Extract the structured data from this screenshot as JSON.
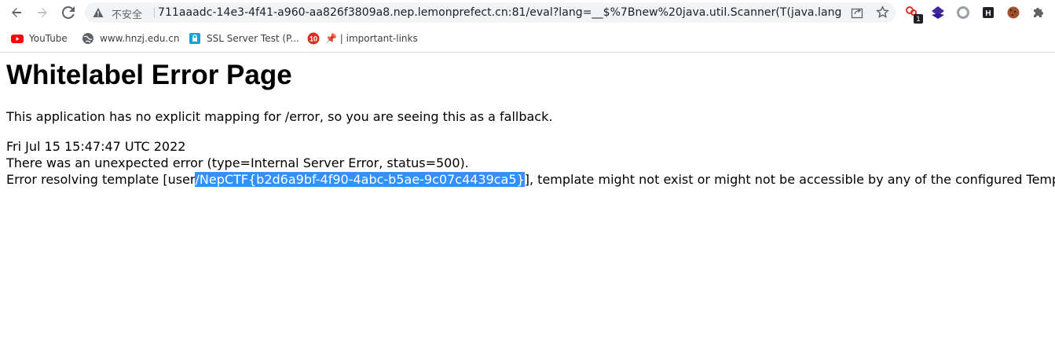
{
  "browser": {
    "security_label": "不安全",
    "url": "711aaadc-14e3-4f41-a960-aa826f3809a8.nep.lemonprefect.cn:81/eval?lang=__$%7Bnew%20java.util.Scanner(T(java.lang.Runtim...",
    "extension_badge": "1",
    "icons": [
      "back-icon",
      "forward-icon",
      "reload-icon",
      "warning-icon",
      "share-icon",
      "star-icon",
      "extension-icon",
      "puzzle-icon"
    ]
  },
  "bookmarks": [
    {
      "label": "YouTube",
      "icon": "youtube-icon"
    },
    {
      "label": "www.hnzj.edu.cn",
      "icon": "globe-icon"
    },
    {
      "label": "SSL Server Test (P...",
      "icon": "ssl-icon"
    },
    {
      "label": "📌 | important-links",
      "icon": "folder-icon"
    }
  ],
  "page": {
    "title": "Whitelabel Error Page",
    "description": "This application has no explicit mapping for /error, so you are seeing this as a fallback.",
    "timestamp": "Fri Jul 15 15:47:47 UTC 2022",
    "error_line": "There was an unexpected error (type=Internal Server Error, status=500).",
    "template_prefix": "Error resolving template [user",
    "template_selected": "/NepCTF{b2d6a9bf-4f90-4abc-b5ae-9c07c4439ca5}",
    "template_suffix": "], template might not exist or might not be accessible by any of the configured Template Reso"
  },
  "colors": {
    "selection": "#3390ff",
    "omnibox_bg": "#f1f3f4"
  }
}
